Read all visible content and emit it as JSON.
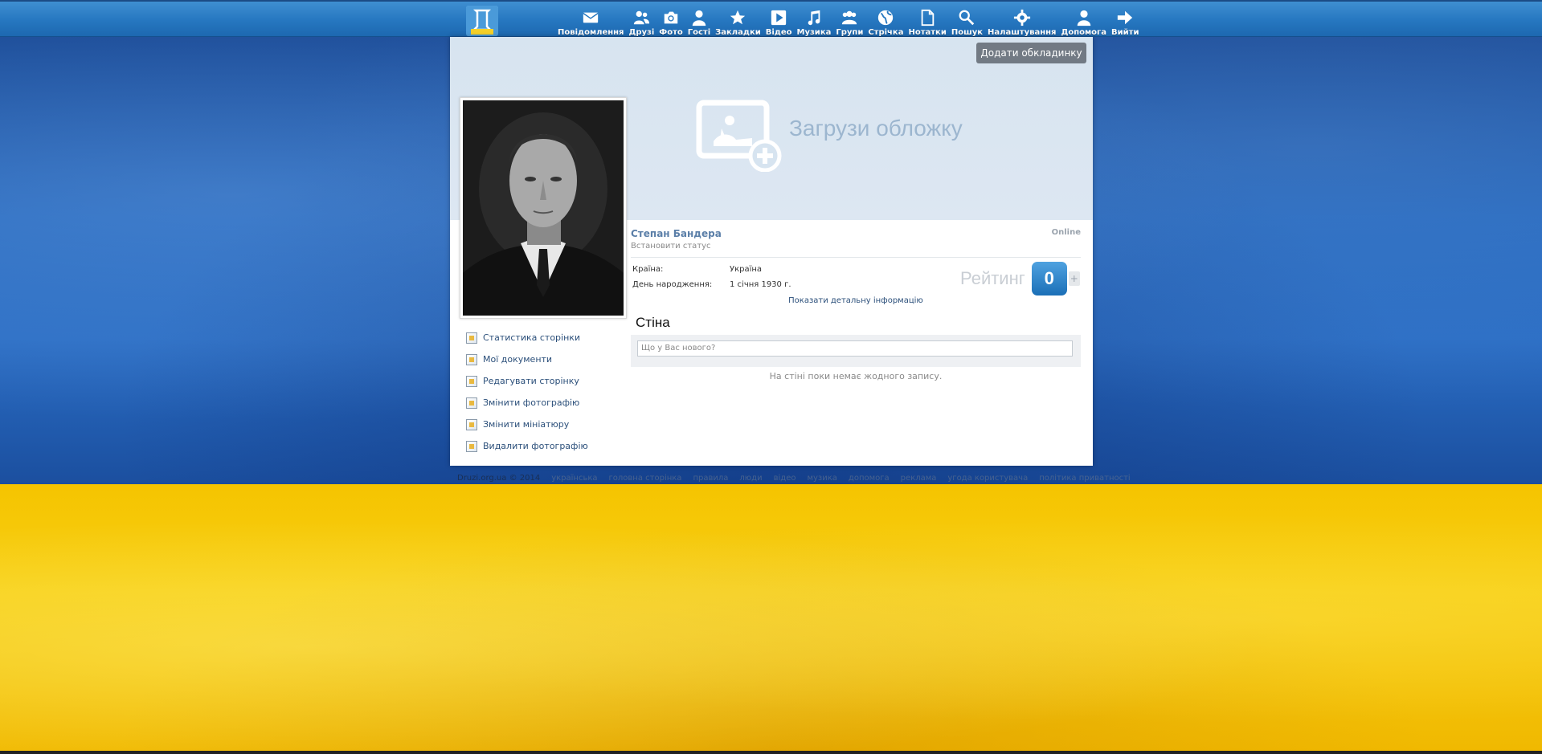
{
  "nav": {
    "items": [
      {
        "label": "Повідомлення",
        "icon": "envelope-icon"
      },
      {
        "label": "Друзі",
        "icon": "friends-icon"
      },
      {
        "label": "Фото",
        "icon": "camera-icon"
      },
      {
        "label": "Гості",
        "icon": "guest-icon"
      },
      {
        "label": "Закладки",
        "icon": "star-icon"
      },
      {
        "label": "Відео",
        "icon": "play-icon"
      },
      {
        "label": "Музика",
        "icon": "music-icon"
      },
      {
        "label": "Групи",
        "icon": "groups-icon"
      },
      {
        "label": "Стрічка",
        "icon": "globe-icon"
      },
      {
        "label": "Нотатки",
        "icon": "note-icon"
      },
      {
        "label": "Пошук",
        "icon": "search-icon"
      },
      {
        "label": "Налаштування",
        "icon": "gear-icon"
      },
      {
        "label": "Допомога",
        "icon": "help-icon"
      },
      {
        "label": "Вийти",
        "icon": "arrow-right-icon"
      }
    ]
  },
  "cover": {
    "add_button": "Додати обкладинку",
    "upload_text": "Загрузи обложку"
  },
  "side_menu": {
    "items": [
      {
        "label": "Статистика сторінки"
      },
      {
        "label": "Мої документи"
      },
      {
        "label": "Редагувати сторінку"
      },
      {
        "label": "Змінити фотографію"
      },
      {
        "label": "Змінити мініатюру"
      },
      {
        "label": "Видалити фотографію"
      }
    ]
  },
  "profile": {
    "name": "Степан Бандера",
    "status": "Встановити статус",
    "online": "Online",
    "country_label": "Країна:",
    "country_value": "Україна",
    "birthday_label": "День народження:",
    "birthday_value": "1 січня 1930 г.",
    "rating_label": "Рейтинг",
    "rating_value": "0",
    "rating_plus": "+",
    "details_link": "Показати детальну інформацію"
  },
  "wall": {
    "title": "Стіна",
    "placeholder": "Що у Вас нового?",
    "empty": "На стіні поки немає жодного запису."
  },
  "footer": {
    "copyright": "Druzi.org.ua © 2014",
    "links": [
      "українська",
      "головна сторінка",
      "правила",
      "люди",
      "відео",
      "музика",
      "допомога",
      "реклама",
      "угода користувача",
      "політика приватності"
    ]
  },
  "colors": {
    "topbar": "#2677c0",
    "flag_blue": "#2366bd",
    "flag_yellow": "#f7cf14",
    "link": "#2b4f7a",
    "rating_badge": "#1b6fb7"
  }
}
